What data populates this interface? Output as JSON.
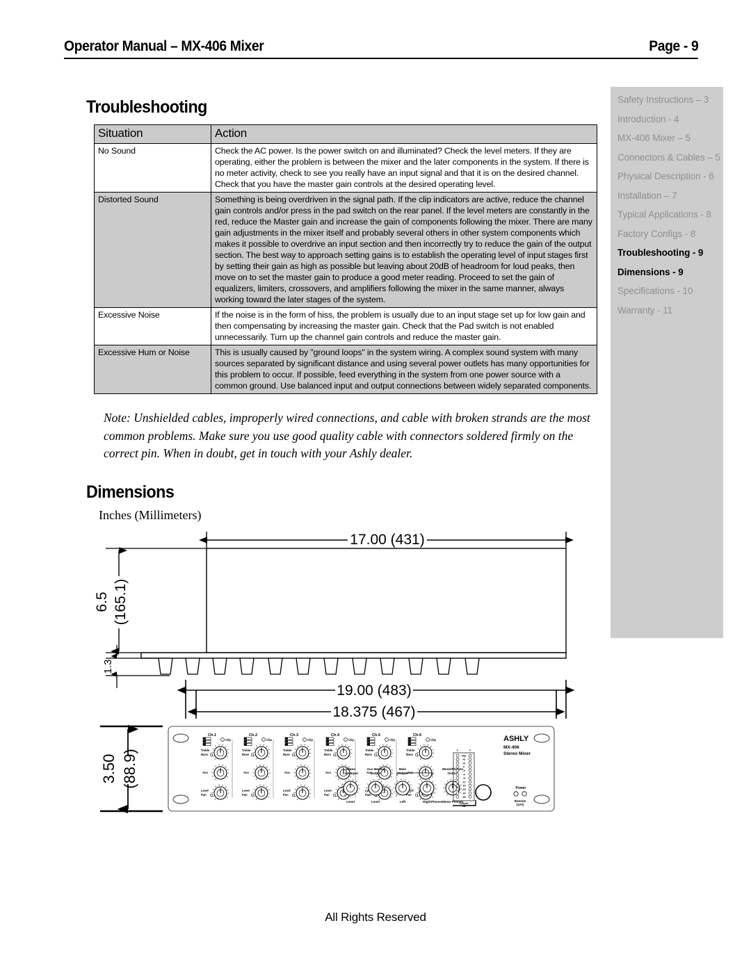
{
  "header": {
    "title": "Operator Manual – MX-406 Mixer",
    "page_label": "Page -  9"
  },
  "toc": {
    "items": [
      {
        "label": "Safety Instructions – 3",
        "current": false
      },
      {
        "label": "Introduction - 4",
        "current": false
      },
      {
        "label": "MX-406 Mixer – 5",
        "current": false
      },
      {
        "label": "Connectors & Cables – 5",
        "current": false
      },
      {
        "label": "Physical Description - 6",
        "current": false
      },
      {
        "label": "Installation – 7",
        "current": false
      },
      {
        "label": "Typical Applications - 8",
        "current": false
      },
      {
        "label": "Factory Configs - 8",
        "current": false
      },
      {
        "label": "Troubleshooting - 9",
        "current": true
      },
      {
        "label": "Dimensions - 9",
        "current": true
      },
      {
        "label": "Specifications - 10",
        "current": false
      },
      {
        "label": "Warranty - 11",
        "current": false
      }
    ]
  },
  "troubleshooting": {
    "heading": "Troubleshooting",
    "columns": [
      "Situation",
      "Action"
    ],
    "rows": [
      {
        "situation": "No Sound",
        "action": "Check the AC power. Is the power switch on and illuminated? Check the level meters. If they are operating, either the problem is between the mixer and the later components in the system. If there is no meter activity, check to see you really have an input signal and that it is on the desired channel. Check that you have the master gain controls at the desired operating level.",
        "shaded": false
      },
      {
        "situation": "Distorted Sound",
        "action": "Something is being overdriven in the signal path. If the clip indicators are active, reduce the channel gain controls and/or press in the pad switch on the rear panel. If the level meters are constantly in the red, reduce the Master gain and increase the gain of components following the mixer. There are many gain adjustments in the mixer itself and probably several others in other system components which makes it possible to overdrive an input section and then incorrectly try to reduce the gain of the output section. The best way to approach setting gains is to establish the operating level of input stages first by setting their gain as high as possible but leaving about 20dB of headroom for loud peaks, then move on to set the master gain to produce a good meter reading. Proceed to set the gain of equalizers, limiters, crossovers, and amplifiers following the mixer in the same manner, always working toward the later stages of the system.",
        "shaded": true
      },
      {
        "situation": "Excessive Noise",
        "action": "If the noise is in the form of hiss, the problem is usually due to an input stage set up for low gain and then compensating by increasing the master gain. Check that the Pad switch is not enabled unnecessarily. Turn up the channel gain controls and reduce the master gain.",
        "shaded": false
      },
      {
        "situation": "Excessive Hum or Noise",
        "action": "This is usually caused by \"ground loops\" in the system wiring. A complex sound system with many sources separated by significant distance and using several power outlets has many opportunities for this problem to occur. If possible, feed everything in the system from one power source with a common ground. Use balanced input and output connections between widely separated components.",
        "shaded": true
      }
    ]
  },
  "note": "Note: Unshielded cables, improperly wired connections, and cable with broken strands are the most common problems. Make sure you use good quality cable with connectors soldered firmly on the correct pin. When in doubt, get in touch with your Ashly dealer.",
  "dimensions": {
    "heading": "Dimensions",
    "units_label": "Inches (Millimeters)",
    "top_width": "17.00 (431)",
    "depth": "6.5",
    "depth_mm": "(165.1)",
    "lip": "1.3",
    "rack_width": "19.00 (483)",
    "panel_width": "18.375 (467)",
    "height": "3.50",
    "height_mm": "(88.9)"
  },
  "front_panel": {
    "brand": "ASHLY",
    "model": "MX-406",
    "product": "Stereo Mixer",
    "channels": [
      "Ch.1",
      "Ch.2",
      "Ch.3",
      "Ch.4",
      "Ch.5",
      "Ch.6"
    ],
    "channel_controls": {
      "clip": "Clip",
      "treble": "Treble",
      "bass": "Bass",
      "aux": "Aux",
      "level": "Level",
      "pan": "Pan"
    },
    "master_controls": [
      {
        "title1": "Stereo",
        "title2": "Line Input",
        "sub": "Level"
      },
      {
        "title1": "Aux Master",
        "title2": "Output",
        "sub": "Level"
      },
      {
        "title1": "Main",
        "title2": "Output",
        "sub": "Left"
      },
      {
        "title1": "",
        "title2": "",
        "sub": "Right"
      },
      {
        "title1": "Mono/Phones",
        "title2": "Output",
        "sub": "Mono    Phones"
      }
    ],
    "meter_labels": [
      "Clip",
      "+6",
      "+3",
      "0",
      "-3",
      "-6",
      "-9",
      "-12",
      "-15",
      "-18",
      "-24",
      "-30"
    ],
    "meter_caption": "Output dB",
    "phones_label": "Phones",
    "power_label": "Power",
    "power_sub1": "Remote",
    "power_sub2": "(12V)"
  },
  "footer": {
    "text": "All Rights Reserved"
  }
}
